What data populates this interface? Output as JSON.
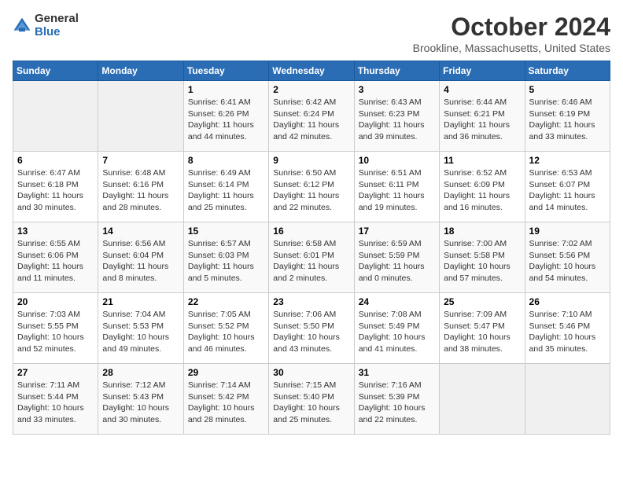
{
  "logo": {
    "general": "General",
    "blue": "Blue"
  },
  "header": {
    "month": "October 2024",
    "location": "Brookline, Massachusetts, United States"
  },
  "weekdays": [
    "Sunday",
    "Monday",
    "Tuesday",
    "Wednesday",
    "Thursday",
    "Friday",
    "Saturday"
  ],
  "weeks": [
    [
      {
        "day": "",
        "info": ""
      },
      {
        "day": "",
        "info": ""
      },
      {
        "day": "1",
        "info": "Sunrise: 6:41 AM\nSunset: 6:26 PM\nDaylight: 11 hours and 44 minutes."
      },
      {
        "day": "2",
        "info": "Sunrise: 6:42 AM\nSunset: 6:24 PM\nDaylight: 11 hours and 42 minutes."
      },
      {
        "day": "3",
        "info": "Sunrise: 6:43 AM\nSunset: 6:23 PM\nDaylight: 11 hours and 39 minutes."
      },
      {
        "day": "4",
        "info": "Sunrise: 6:44 AM\nSunset: 6:21 PM\nDaylight: 11 hours and 36 minutes."
      },
      {
        "day": "5",
        "info": "Sunrise: 6:46 AM\nSunset: 6:19 PM\nDaylight: 11 hours and 33 minutes."
      }
    ],
    [
      {
        "day": "6",
        "info": "Sunrise: 6:47 AM\nSunset: 6:18 PM\nDaylight: 11 hours and 30 minutes."
      },
      {
        "day": "7",
        "info": "Sunrise: 6:48 AM\nSunset: 6:16 PM\nDaylight: 11 hours and 28 minutes."
      },
      {
        "day": "8",
        "info": "Sunrise: 6:49 AM\nSunset: 6:14 PM\nDaylight: 11 hours and 25 minutes."
      },
      {
        "day": "9",
        "info": "Sunrise: 6:50 AM\nSunset: 6:12 PM\nDaylight: 11 hours and 22 minutes."
      },
      {
        "day": "10",
        "info": "Sunrise: 6:51 AM\nSunset: 6:11 PM\nDaylight: 11 hours and 19 minutes."
      },
      {
        "day": "11",
        "info": "Sunrise: 6:52 AM\nSunset: 6:09 PM\nDaylight: 11 hours and 16 minutes."
      },
      {
        "day": "12",
        "info": "Sunrise: 6:53 AM\nSunset: 6:07 PM\nDaylight: 11 hours and 14 minutes."
      }
    ],
    [
      {
        "day": "13",
        "info": "Sunrise: 6:55 AM\nSunset: 6:06 PM\nDaylight: 11 hours and 11 minutes."
      },
      {
        "day": "14",
        "info": "Sunrise: 6:56 AM\nSunset: 6:04 PM\nDaylight: 11 hours and 8 minutes."
      },
      {
        "day": "15",
        "info": "Sunrise: 6:57 AM\nSunset: 6:03 PM\nDaylight: 11 hours and 5 minutes."
      },
      {
        "day": "16",
        "info": "Sunrise: 6:58 AM\nSunset: 6:01 PM\nDaylight: 11 hours and 2 minutes."
      },
      {
        "day": "17",
        "info": "Sunrise: 6:59 AM\nSunset: 5:59 PM\nDaylight: 11 hours and 0 minutes."
      },
      {
        "day": "18",
        "info": "Sunrise: 7:00 AM\nSunset: 5:58 PM\nDaylight: 10 hours and 57 minutes."
      },
      {
        "day": "19",
        "info": "Sunrise: 7:02 AM\nSunset: 5:56 PM\nDaylight: 10 hours and 54 minutes."
      }
    ],
    [
      {
        "day": "20",
        "info": "Sunrise: 7:03 AM\nSunset: 5:55 PM\nDaylight: 10 hours and 52 minutes."
      },
      {
        "day": "21",
        "info": "Sunrise: 7:04 AM\nSunset: 5:53 PM\nDaylight: 10 hours and 49 minutes."
      },
      {
        "day": "22",
        "info": "Sunrise: 7:05 AM\nSunset: 5:52 PM\nDaylight: 10 hours and 46 minutes."
      },
      {
        "day": "23",
        "info": "Sunrise: 7:06 AM\nSunset: 5:50 PM\nDaylight: 10 hours and 43 minutes."
      },
      {
        "day": "24",
        "info": "Sunrise: 7:08 AM\nSunset: 5:49 PM\nDaylight: 10 hours and 41 minutes."
      },
      {
        "day": "25",
        "info": "Sunrise: 7:09 AM\nSunset: 5:47 PM\nDaylight: 10 hours and 38 minutes."
      },
      {
        "day": "26",
        "info": "Sunrise: 7:10 AM\nSunset: 5:46 PM\nDaylight: 10 hours and 35 minutes."
      }
    ],
    [
      {
        "day": "27",
        "info": "Sunrise: 7:11 AM\nSunset: 5:44 PM\nDaylight: 10 hours and 33 minutes."
      },
      {
        "day": "28",
        "info": "Sunrise: 7:12 AM\nSunset: 5:43 PM\nDaylight: 10 hours and 30 minutes."
      },
      {
        "day": "29",
        "info": "Sunrise: 7:14 AM\nSunset: 5:42 PM\nDaylight: 10 hours and 28 minutes."
      },
      {
        "day": "30",
        "info": "Sunrise: 7:15 AM\nSunset: 5:40 PM\nDaylight: 10 hours and 25 minutes."
      },
      {
        "day": "31",
        "info": "Sunrise: 7:16 AM\nSunset: 5:39 PM\nDaylight: 10 hours and 22 minutes."
      },
      {
        "day": "",
        "info": ""
      },
      {
        "day": "",
        "info": ""
      }
    ]
  ]
}
